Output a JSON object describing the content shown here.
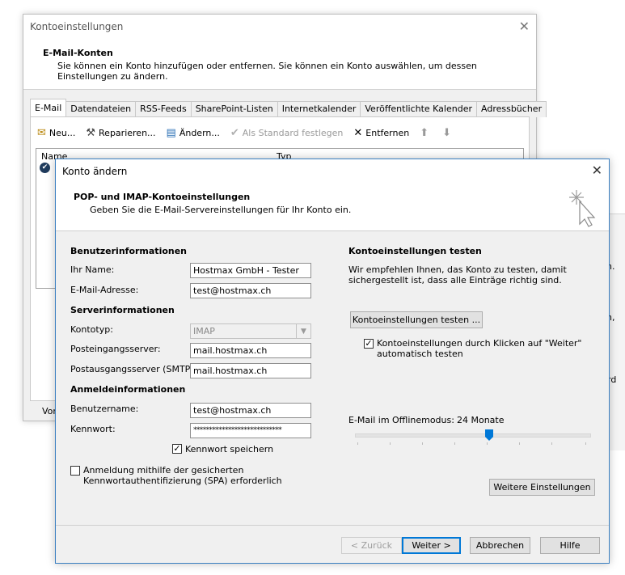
{
  "bg_window": {
    "title": "Kontoeinstellungen",
    "header_title": "E-Mail-Konten",
    "header_desc": "Sie können ein Konto hinzufügen oder entfernen. Sie können ein Konto auswählen, um dessen Einstellungen zu ändern.",
    "tabs": [
      "E-Mail",
      "Datendateien",
      "RSS-Feeds",
      "SharePoint-Listen",
      "Internetkalender",
      "Veröffentlichte Kalender",
      "Adressbücher"
    ],
    "toolbar": {
      "new": "Neu...",
      "repair": "Reparieren...",
      "change": "Ändern...",
      "set_default": "Als Standard festlegen",
      "remove": "Entfernen"
    },
    "list_header_name": "Name",
    "list_header_type": "Typ",
    "bottom_label": "Vom",
    "right_fragments": [
      "n.",
      "n,",
      "ird"
    ]
  },
  "dialog": {
    "title": "Konto ändern",
    "header_title": "POP- und IMAP-Kontoeinstellungen",
    "header_desc": "Geben Sie die E-Mail-Servereinstellungen für Ihr Konto ein.",
    "user_info": {
      "heading": "Benutzerinformationen",
      "name_label": "Ihr Name:",
      "name_value": "Hostmax GmbH - Tester",
      "email_label": "E-Mail-Adresse:",
      "email_value": "test@hostmax.ch"
    },
    "server_info": {
      "heading": "Serverinformationen",
      "type_label": "Kontotyp:",
      "type_value": "IMAP",
      "incoming_label": "Posteingangsserver:",
      "incoming_value": "mail.hostmax.ch",
      "outgoing_label": "Postausgangsserver (SMTP):",
      "outgoing_value": "mail.hostmax.ch"
    },
    "login_info": {
      "heading": "Anmeldeinformationen",
      "user_label": "Benutzername:",
      "user_value": "test@hostmax.ch",
      "password_label": "Kennwort:",
      "password_value": "****************************",
      "save_password": "Kennwort speichern",
      "save_password_checked": true,
      "spa_label_line1": "Anmeldung mithilfe der gesicherten",
      "spa_label_line2": "Kennwortauthentifizierung (SPA) erforderlich",
      "spa_checked": false
    },
    "test": {
      "heading": "Kontoeinstellungen testen",
      "desc_line1": "Wir empfehlen Ihnen, das Konto zu testen, damit",
      "desc_line2": "sichergestellt ist, dass alle Einträge richtig sind.",
      "button": "Kontoeinstellungen testen ...",
      "auto_test_line1": "Kontoeinstellungen durch Klicken auf \"Weiter\"",
      "auto_test_line2": "automatisch testen",
      "auto_test_checked": true
    },
    "offline": {
      "label": "E-Mail im Offlinemodus:",
      "value": "24 Monate",
      "slider_fraction": 0.57
    },
    "more_settings": "Weitere Einstellungen",
    "buttons": {
      "back": "< Zurück",
      "next": "Weiter >",
      "cancel": "Abbrechen",
      "help": "Hilfe"
    }
  },
  "colors": {
    "accent": "#0078d7",
    "dialog_bg": "#f0f0f0"
  }
}
